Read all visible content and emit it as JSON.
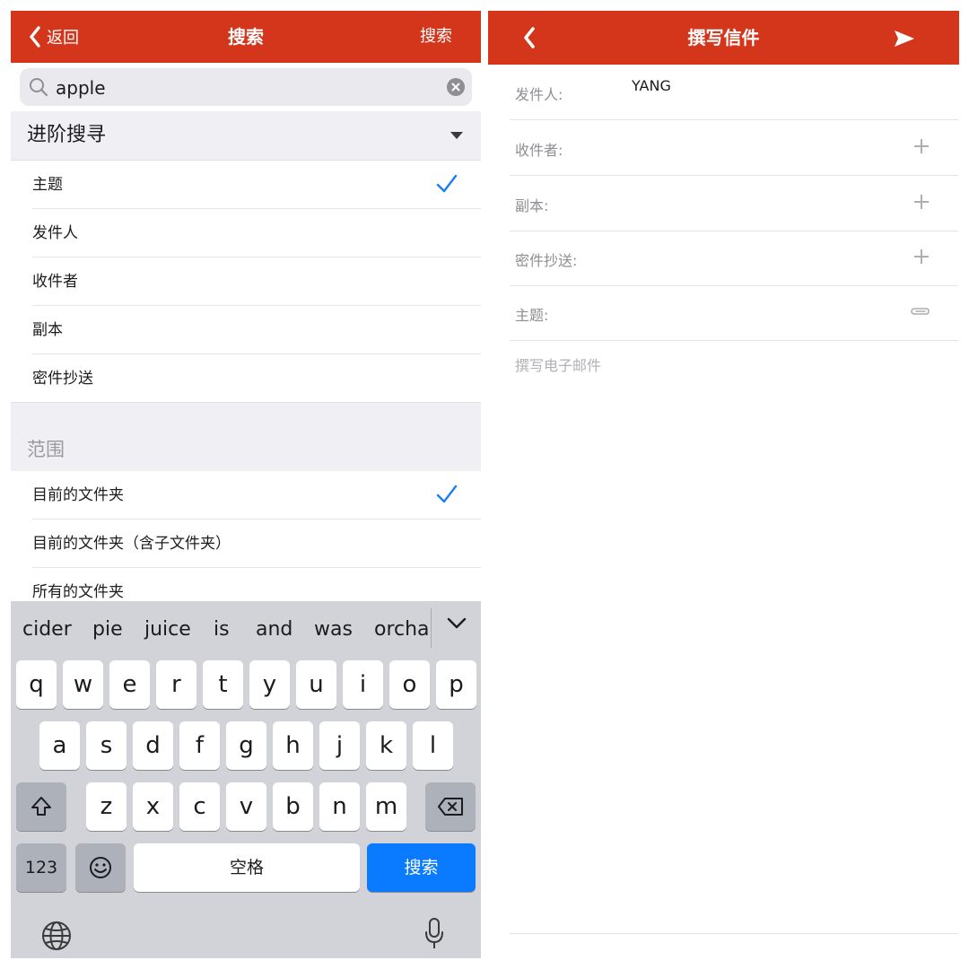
{
  "colors": {
    "brand_red": "#d4361c",
    "check_blue": "#1a7ff5",
    "key_blue": "#0a7bff"
  },
  "search_screen": {
    "nav": {
      "back_label": "返回",
      "title": "搜索",
      "action_label": "搜索"
    },
    "search": {
      "value": "apple"
    },
    "advanced": {
      "title": "进阶搜寻",
      "options": [
        {
          "label": "主题",
          "checked": true
        },
        {
          "label": "发件人",
          "checked": false
        },
        {
          "label": "收件者",
          "checked": false
        },
        {
          "label": "副本",
          "checked": false
        },
        {
          "label": "密件抄送",
          "checked": false
        }
      ]
    },
    "scope": {
      "title": "范围",
      "options": [
        {
          "label": "目前的文件夹",
          "checked": true
        },
        {
          "label": "目前的文件夹（含子文件夹）",
          "checked": false
        },
        {
          "label": "所有的文件夹",
          "checked": false
        }
      ]
    },
    "keyboard": {
      "suggestions": [
        "cider",
        "pie",
        "juice",
        "is",
        "and",
        "was",
        "orchai"
      ],
      "row1": [
        "q",
        "w",
        "e",
        "r",
        "t",
        "y",
        "u",
        "i",
        "o",
        "p"
      ],
      "row2": [
        "a",
        "s",
        "d",
        "f",
        "g",
        "h",
        "j",
        "k",
        "l"
      ],
      "row3": [
        "z",
        "x",
        "c",
        "v",
        "b",
        "n",
        "m"
      ],
      "numbers_label": "123",
      "space_label": "空格",
      "return_label": "搜索",
      "icons": [
        "shift-icon",
        "backspace-icon",
        "emoji-icon",
        "globe-icon",
        "microphone-icon",
        "chevron-down-icon"
      ]
    }
  },
  "compose_screen": {
    "nav": {
      "title": "撰写信件",
      "icons": [
        "back-chevron-icon",
        "send-icon"
      ]
    },
    "fields": {
      "from": {
        "label": "发件人:",
        "value": "YANG"
      },
      "to": {
        "label": "收件者:"
      },
      "cc": {
        "label": "副本:"
      },
      "bcc": {
        "label": "密件抄送:"
      },
      "subject": {
        "label": "主题:"
      }
    },
    "body_placeholder": "撰写电子邮件"
  }
}
